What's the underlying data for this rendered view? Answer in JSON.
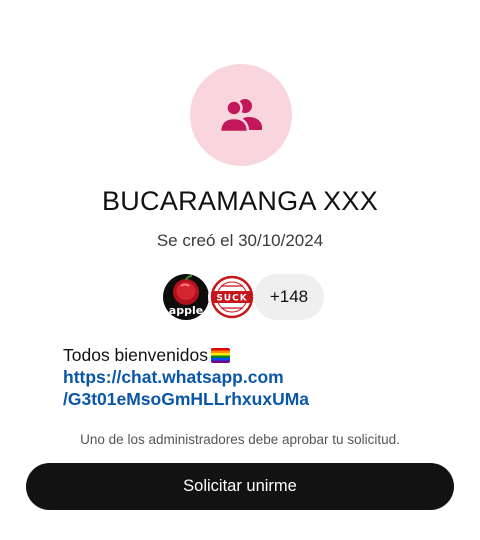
{
  "group": {
    "name": "BUCARAMANGA XXX",
    "created": "Se creó el 30/10/2024",
    "icon": "group-people-icon",
    "accent_color": "#c2185b",
    "avatar_bg": "#f9d5dd"
  },
  "members": {
    "avatars": [
      {
        "label": "apple",
        "icon": "apple-avatar"
      },
      {
        "label": "SUCK",
        "icon": "stamp-avatar"
      }
    ],
    "extra_count": "+148"
  },
  "description": {
    "text": "Todos bienvenidos",
    "emoji": "rainbow-flag-icon",
    "link_line1": "https://chat.whatsapp.com",
    "link_line2": "/G3t01eMsoGmHLLrhxuxUMa"
  },
  "approval_note": "Uno de los administradores debe aprobar tu solicitud.",
  "request_button": {
    "label": "Solicitar unirme",
    "bg_color": "#121212"
  }
}
